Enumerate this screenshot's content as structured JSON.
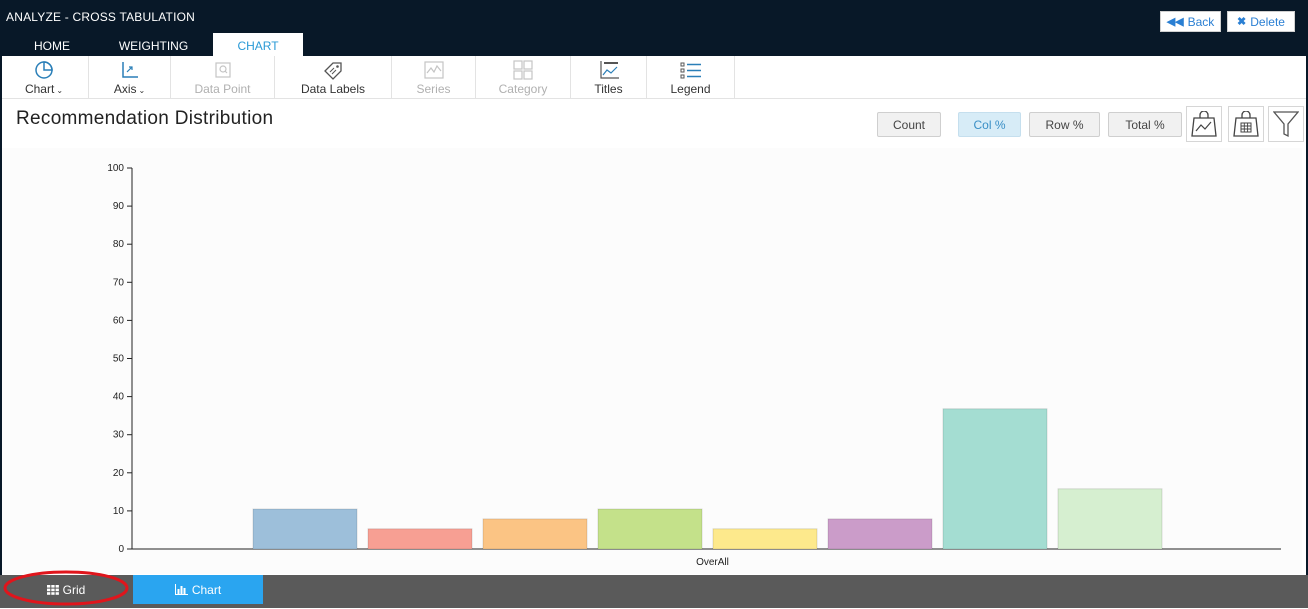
{
  "app": {
    "title": "ANALYZE - CROSS TABULATION"
  },
  "header": {
    "back_label": "Back",
    "delete_label": "Delete"
  },
  "tabs": [
    {
      "label": "HOME",
      "active": false
    },
    {
      "label": "WEIGHTING",
      "active": false
    },
    {
      "label": "CHART",
      "active": true
    }
  ],
  "ribbon": {
    "items": [
      {
        "label": "Chart",
        "icon": "pie-chart-icon",
        "dropdown": true,
        "enabled": true
      },
      {
        "label": "Axis",
        "icon": "axis-icon",
        "dropdown": true,
        "enabled": true
      },
      {
        "label": "Data Point",
        "icon": "data-point-icon",
        "dropdown": false,
        "enabled": false
      },
      {
        "label": "Data Labels",
        "icon": "tag-icon",
        "dropdown": false,
        "enabled": true
      },
      {
        "label": "Series",
        "icon": "series-icon",
        "dropdown": false,
        "enabled": false
      },
      {
        "label": "Category",
        "icon": "category-icon",
        "dropdown": false,
        "enabled": false
      },
      {
        "label": "Titles",
        "icon": "titles-icon",
        "dropdown": false,
        "enabled": true
      },
      {
        "label": "Legend",
        "icon": "legend-icon",
        "dropdown": false,
        "enabled": true
      }
    ]
  },
  "page": {
    "title": "Recommendation Distribution"
  },
  "toolbar": {
    "modes": [
      {
        "label": "Count",
        "active": false
      },
      {
        "label": "Col %",
        "active": true
      },
      {
        "label": "Row %",
        "active": false
      },
      {
        "label": "Total %",
        "active": false
      }
    ],
    "icon_buttons": [
      "chart-lock-icon",
      "table-lock-icon",
      "filter-icon"
    ]
  },
  "chart_data": {
    "type": "bar",
    "categories": [
      "OverAll"
    ],
    "series": [
      {
        "values": [
          10.5
        ],
        "color": "#9dbfda"
      },
      {
        "values": [
          5.3
        ],
        "color": "#f79f93"
      },
      {
        "values": [
          7.9
        ],
        "color": "#fbc484"
      },
      {
        "values": [
          10.5
        ],
        "color": "#c4e18a"
      },
      {
        "values": [
          5.3
        ],
        "color": "#fde98c"
      },
      {
        "values": [
          7.9
        ],
        "color": "#cb9cc9"
      },
      {
        "values": [
          36.8
        ],
        "color": "#a4ddd2"
      },
      {
        "values": [
          15.8
        ],
        "color": "#d6efd0"
      }
    ],
    "ylim": [
      0,
      100
    ],
    "y_ticks": [
      "0",
      "10",
      "20",
      "30",
      "40",
      "50",
      "60",
      "70",
      "80",
      "90",
      "100"
    ],
    "grid": false,
    "xlabel": "",
    "ylabel": ""
  },
  "footer": {
    "tabs": [
      {
        "label": "Grid",
        "icon": "grid-icon",
        "active": false
      },
      {
        "label": "Chart",
        "icon": "bar-chart-icon",
        "active": true
      }
    ]
  },
  "colors": {
    "header_bg": "#081828",
    "accent": "#2aa5f0",
    "footer_bg": "#5a5a5a"
  }
}
